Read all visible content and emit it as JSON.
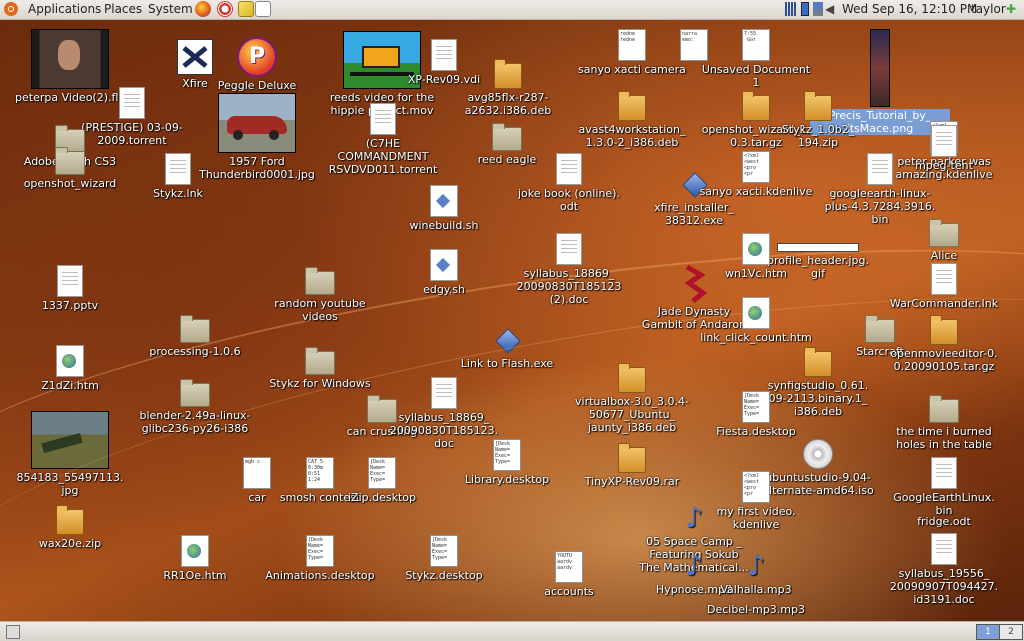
{
  "top_panel": {
    "menus": [
      "Applications",
      "Places",
      "System"
    ],
    "clock": "Wed Sep 16, 12:10 PM",
    "user": "taylor",
    "launchers": [
      "firefox-icon",
      "help-icon",
      "notes-icon",
      "editor-icon"
    ],
    "tray_icons": [
      "network-icon",
      "battery-icon",
      "transfer-icon",
      "volume-icon"
    ]
  },
  "desktop": {
    "icons": [
      {
        "name": "peter-parker-video",
        "label": "peterpa Video(2).flv",
        "kind": "thumb-video"
      },
      {
        "name": "xfire",
        "label": "Xfire",
        "kind": "xfire"
      },
      {
        "name": "peggle-deluxe",
        "label": "Peggle Deluxe",
        "kind": "peggle"
      },
      {
        "name": "reeds-video",
        "label": "reeds video for the\nhippie project.mov",
        "kind": "thumb-cartoon"
      },
      {
        "name": "xp-rev09-vdi",
        "label": "XP-Rev09.vdi",
        "kind": "doc"
      },
      {
        "name": "avg85flx",
        "label": "avg85flx-r287-\na2632.i386.deb",
        "kind": "zip"
      },
      {
        "name": "sanyo-xacti-camera",
        "label": "sanyo xacti camera",
        "kind": "txt",
        "content": "redne\nredne"
      },
      {
        "name": "narra-memo",
        "label": "",
        "kind": "txt",
        "content": "narra\nemo:"
      },
      {
        "name": "unsaved-document",
        "label": "Unsaved Document\n1",
        "kind": "txt",
        "content": "7:55\n Gor"
      },
      {
        "name": "precis-tutorial",
        "label": "Precis_Tutorial_by_\nitsMace.png",
        "kind": "thumb-tall",
        "selected": true
      },
      {
        "name": "prestige-torrent",
        "label": "(PRESTIGE) 03-09-\n2009.torrent",
        "kind": "doc"
      },
      {
        "name": "adobe-cs3",
        "label": "Adobe Flash CS3",
        "kind": "folder"
      },
      {
        "name": "openshot-wizard-folder",
        "label": "openshot_wizard",
        "kind": "folder"
      },
      {
        "name": "ford-thunderbird",
        "label": "1957 Ford\nThunderbird0001.jpg",
        "kind": "thumb-car"
      },
      {
        "name": "stykz-lnk",
        "label": "Stykz.lnk",
        "kind": "doc"
      },
      {
        "name": "overlapping-torrents",
        "label": "(C7HE\nCOMMANDMENT\nRSVDVD011.torrent",
        "kind": "doc"
      },
      {
        "name": "reed-eagle",
        "label": "reed eagle",
        "kind": "folder"
      },
      {
        "name": "avast-deb",
        "label": "avast4workstation_\n1.3.0-2_i386.deb",
        "kind": "zip"
      },
      {
        "name": "openshot-targz",
        "label": "openshot_wizard_1.\n0.3.tar.gz",
        "kind": "zip"
      },
      {
        "name": "stykz-zip",
        "label": "Stykz_1.0b2_\n194.zip",
        "kind": "zip"
      },
      {
        "name": "peter-parker-kdenlive",
        "label": "peter parker was\namazing.kdenlive",
        "kind": "txt",
        "content": "<?xml\n<west\n<pro\n<pr"
      },
      {
        "name": "mpeg-tent",
        "label": "mpeg-tent",
        "kind": "doc"
      },
      {
        "name": "joke-book",
        "label": "joke book (online).\nodt",
        "kind": "doc"
      },
      {
        "name": "winebuild",
        "label": "winebuild.sh",
        "kind": "sh"
      },
      {
        "name": "xfire-installer",
        "label": "xfire_installer_\n38312.exe",
        "kind": "flash"
      },
      {
        "name": "sanyo-kdenlive",
        "label": "sanyo xacti.kdenlive",
        "kind": "txt",
        "content": "<?xml\n<west\n<pro\n<pr"
      },
      {
        "name": "googleearth-bin",
        "label": "googleearth-linux-\nplus-4.3.7284.3916.\nbin",
        "kind": "doc"
      },
      {
        "name": "profile-header",
        "label": "profile_header.jpg.\ngif",
        "kind": "bar"
      },
      {
        "name": "alice",
        "label": "Alice",
        "kind": "folder"
      },
      {
        "name": "edgy-sh",
        "label": "edgy.sh",
        "kind": "sh"
      },
      {
        "name": "syllabus-2",
        "label": "syllabus_18869_\n20090830T185123\n(2).doc",
        "kind": "doc"
      },
      {
        "name": "wn1vc",
        "label": "wn1Vc.htm",
        "kind": "html"
      },
      {
        "name": "warcommander",
        "label": "WarCommander.lnk",
        "kind": "doc"
      },
      {
        "name": "pptv",
        "label": "1337.pptv",
        "kind": "doc"
      },
      {
        "name": "random-youtube",
        "label": "random youtube\nvideos",
        "kind": "folder"
      },
      {
        "name": "jade-dynasty",
        "label": "Jade Dynasty\nGambit of Andaron",
        "kind": "jade"
      },
      {
        "name": "link-click-count",
        "label": "link_click_count.htm",
        "kind": "html"
      },
      {
        "name": "processing",
        "label": "processing-1.0.6",
        "kind": "folder"
      },
      {
        "name": "starcraft",
        "label": "Starcraft",
        "kind": "folder"
      },
      {
        "name": "openmovieeditor",
        "label": "openmovieeditor-0.\n0.20090105.tar.gz",
        "kind": "zip"
      },
      {
        "name": "z1dzi",
        "label": "Z1dZi.htm",
        "kind": "html"
      },
      {
        "name": "stykz-windows",
        "label": "Stykz for Windows",
        "kind": "folder"
      },
      {
        "name": "link-flash",
        "label": "Link to Flash.exe",
        "kind": "flash"
      },
      {
        "name": "synfig",
        "label": "synfigstudio_0.61.\n09-2113.binary.1_\ni386.deb",
        "kind": "zip"
      },
      {
        "name": "blender",
        "label": "blender-2.49a-linux-\nglibc236-py26-i386",
        "kind": "folder"
      },
      {
        "name": "virtualbox",
        "label": "virtualbox-3.0_3.0.4-\n50677_Ubuntu_\njaunty_i386.deb",
        "kind": "zip"
      },
      {
        "name": "can-crushing",
        "label": "can crushing",
        "kind": "folder"
      },
      {
        "name": "syllabus-doc",
        "label": "syllabus_18869_\n20090830T185123.\ndoc",
        "kind": "doc"
      },
      {
        "name": "fiesta",
        "label": "Fiesta.desktop",
        "kind": "txt",
        "content": "[Desk\nName=\nExec=\nType="
      },
      {
        "name": "time-burned",
        "label": "the time i burned\nholes in the table",
        "kind": "folder"
      },
      {
        "name": "screenshot-jpg",
        "label": "854183_55497113.\njpg",
        "kind": "thumb-game"
      },
      {
        "name": "car",
        "label": "car",
        "kind": "txt",
        "content": "mgb c"
      },
      {
        "name": "smosh-contest",
        "label": "smosh contest",
        "kind": "txt",
        "content": "CAT 5\n0:30m\n0:51\n1:24"
      },
      {
        "name": "izip-desktop",
        "label": "iZip.desktop",
        "kind": "txt",
        "content": "[Desk\nName=\nExec=\nType="
      },
      {
        "name": "library-desktop",
        "label": "Library.desktop",
        "kind": "txt",
        "content": "[Desk\nName=\nExec=\nType="
      },
      {
        "name": "tinyxp",
        "label": "TinyXP-Rev09.rar",
        "kind": "zip"
      },
      {
        "name": "ubuntu-iso",
        "label": "ubuntustudio-9.04-\nalternate-amd64.iso",
        "kind": "disc"
      },
      {
        "name": "googleearth-linux-bin",
        "label": "GoogleEarthLinux.\nbin",
        "kind": "doc"
      },
      {
        "name": "wax20e",
        "label": "wax20e.zip",
        "kind": "zip"
      },
      {
        "name": "first-video",
        "label": "my first video.\nkdenlive",
        "kind": "txt",
        "content": "<?xml\n<west\n<pro\n<pr"
      },
      {
        "name": "fridge-odt",
        "label": "fridge.odt",
        "kind": "none"
      },
      {
        "name": "space-camp",
        "label": "05 Space Camp _\nFeaturing Sokub\nThe Mathematical...",
        "kind": "music"
      },
      {
        "name": "rr1oe",
        "label": "RR1Oe.htm",
        "kind": "html"
      },
      {
        "name": "animations-desktop",
        "label": "Animations.desktop",
        "kind": "txt",
        "content": "[Desk\nName=\nExec=\nType="
      },
      {
        "name": "stykz-desktop",
        "label": "Stykz.desktop",
        "kind": "txt",
        "content": "[Desk\nName=\nExec=\nType="
      },
      {
        "name": "accounts",
        "label": "accounts",
        "kind": "txt",
        "content": "YOUTU\naardv\naardv"
      },
      {
        "name": "hypnose",
        "label": "Hypnose.mp3",
        "kind": "music"
      },
      {
        "name": "valhalla",
        "label": "Valhalla.mp3",
        "kind": "music"
      },
      {
        "name": "decibel",
        "label": "Decibel-mp3.mp3",
        "kind": "none"
      },
      {
        "name": "syllabus-3",
        "label": "syllabus_19556_\n20090907T094427.\nid3191.doc",
        "kind": "doc"
      }
    ]
  },
  "bottom_panel": {
    "workspaces": [
      "1",
      "2"
    ]
  }
}
